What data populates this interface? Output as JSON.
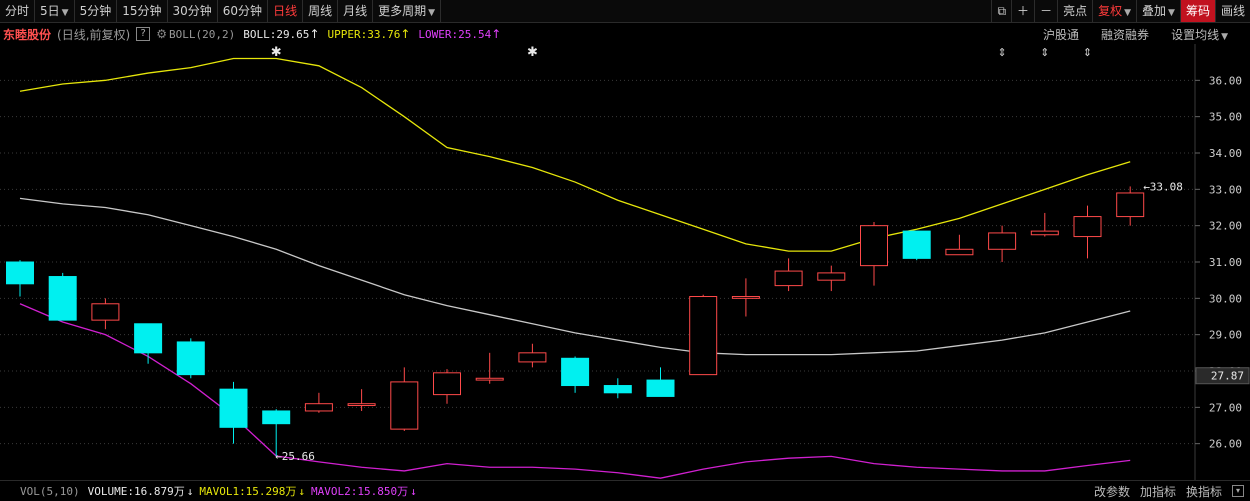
{
  "toolbar": {
    "periods": [
      "分时",
      "5日",
      "5分钟",
      "15分钟",
      "30分钟",
      "60分钟",
      "日线",
      "周线",
      "月线",
      "更多周期"
    ],
    "active_period": "日线",
    "right_buttons": [
      "亮点",
      "复权",
      "叠加",
      "筹码",
      "画线"
    ]
  },
  "info": {
    "stock_name": "东睦股份",
    "subtitle": "(日线,前复权)",
    "help": "?",
    "indicator": "BOLL(20,2)",
    "boll": "BOLL:29.65",
    "upper": "UPPER:33.76",
    "lower": "LOWER:25.54",
    "links": [
      "沪股通",
      "融资融券",
      "设置均线"
    ]
  },
  "volume_bar": {
    "name": "VOL(5,10)",
    "volume": "VOLUME:16.879万",
    "mavol1": "MAVOL1:15.298万",
    "mavol2": "MAVOL2:15.850万",
    "links": [
      "改参数",
      "加指标",
      "换指标"
    ]
  },
  "colors": {
    "up": "#ff4a4a",
    "down": "#00f0f0",
    "mid": "#c8c8c8",
    "upper": "#e6e60a",
    "lower": "#d020d0"
  },
  "chart_data": {
    "type": "candlestick",
    "ylim": [
      25.0,
      37.0
    ],
    "y_ticks": [
      "36.00",
      "35.00",
      "34.00",
      "33.00",
      "32.00",
      "31.00",
      "30.00",
      "29.00",
      "28.00",
      "27.00",
      "26.00"
    ],
    "current_price": "27.87",
    "annotations": {
      "high": "33.08",
      "low": "25.66"
    },
    "candles": [
      {
        "o": 31.0,
        "h": 31.05,
        "l": 30.05,
        "c": 30.4
      },
      {
        "o": 30.6,
        "h": 30.7,
        "l": 29.4,
        "c": 29.4
      },
      {
        "o": 29.4,
        "h": 30.0,
        "l": 29.15,
        "c": 29.85
      },
      {
        "o": 29.3,
        "h": 29.3,
        "l": 28.2,
        "c": 28.5
      },
      {
        "o": 28.8,
        "h": 28.9,
        "l": 27.8,
        "c": 27.9
      },
      {
        "o": 27.5,
        "h": 27.7,
        "l": 26.0,
        "c": 26.45
      },
      {
        "o": 26.9,
        "h": 26.95,
        "l": 25.66,
        "c": 26.55
      },
      {
        "o": 26.9,
        "h": 27.4,
        "l": 26.85,
        "c": 27.1
      },
      {
        "o": 27.05,
        "h": 27.5,
        "l": 26.9,
        "c": 27.1
      },
      {
        "o": 26.4,
        "h": 28.1,
        "l": 26.35,
        "c": 27.7
      },
      {
        "o": 27.35,
        "h": 28.05,
        "l": 27.1,
        "c": 27.95
      },
      {
        "o": 27.75,
        "h": 28.5,
        "l": 27.65,
        "c": 27.8
      },
      {
        "o": 28.25,
        "h": 28.75,
        "l": 28.1,
        "c": 28.5
      },
      {
        "o": 28.35,
        "h": 28.4,
        "l": 27.4,
        "c": 27.6
      },
      {
        "o": 27.6,
        "h": 27.8,
        "l": 27.25,
        "c": 27.4
      },
      {
        "o": 27.75,
        "h": 28.1,
        "l": 27.3,
        "c": 27.3
      },
      {
        "o": 27.9,
        "h": 30.1,
        "l": 27.9,
        "c": 30.05
      },
      {
        "o": 30.0,
        "h": 30.55,
        "l": 29.5,
        "c": 30.05
      },
      {
        "o": 30.35,
        "h": 31.1,
        "l": 30.2,
        "c": 30.75
      },
      {
        "o": 30.5,
        "h": 30.9,
        "l": 30.2,
        "c": 30.7
      },
      {
        "o": 30.9,
        "h": 32.1,
        "l": 30.35,
        "c": 32.0
      },
      {
        "o": 31.85,
        "h": 31.85,
        "l": 31.05,
        "c": 31.1
      },
      {
        "o": 31.2,
        "h": 31.75,
        "l": 31.2,
        "c": 31.35
      },
      {
        "o": 31.35,
        "h": 32.0,
        "l": 31.0,
        "c": 31.8
      },
      {
        "o": 31.75,
        "h": 32.35,
        "l": 31.7,
        "c": 31.85
      },
      {
        "o": 31.7,
        "h": 32.55,
        "l": 31.1,
        "c": 32.25
      },
      {
        "o": 32.25,
        "h": 33.08,
        "l": 32.0,
        "c": 32.9
      }
    ],
    "upper": [
      35.7,
      35.9,
      36.0,
      36.2,
      36.35,
      36.6,
      36.6,
      36.4,
      35.8,
      35.0,
      34.15,
      33.9,
      33.6,
      33.2,
      32.7,
      32.3,
      31.9,
      31.5,
      31.3,
      31.3,
      31.65,
      31.9,
      32.2,
      32.6,
      33.0,
      33.4,
      33.76
    ],
    "mid": [
      32.75,
      32.6,
      32.5,
      32.3,
      32.0,
      31.7,
      31.35,
      30.9,
      30.5,
      30.1,
      29.8,
      29.55,
      29.3,
      29.05,
      28.85,
      28.65,
      28.5,
      28.45,
      28.45,
      28.45,
      28.5,
      28.55,
      28.7,
      28.85,
      29.05,
      29.35,
      29.65
    ],
    "lower": [
      29.85,
      29.35,
      29.0,
      28.4,
      27.65,
      26.75,
      25.66,
      25.5,
      25.35,
      25.25,
      25.45,
      25.35,
      25.35,
      25.3,
      25.2,
      25.05,
      25.3,
      25.5,
      25.6,
      25.65,
      25.45,
      25.35,
      25.3,
      25.25,
      25.25,
      25.4,
      25.54
    ],
    "markers": {
      "star_candles": [
        6,
        12
      ],
      "double_arrow_candles": [
        23,
        24,
        25
      ]
    }
  }
}
